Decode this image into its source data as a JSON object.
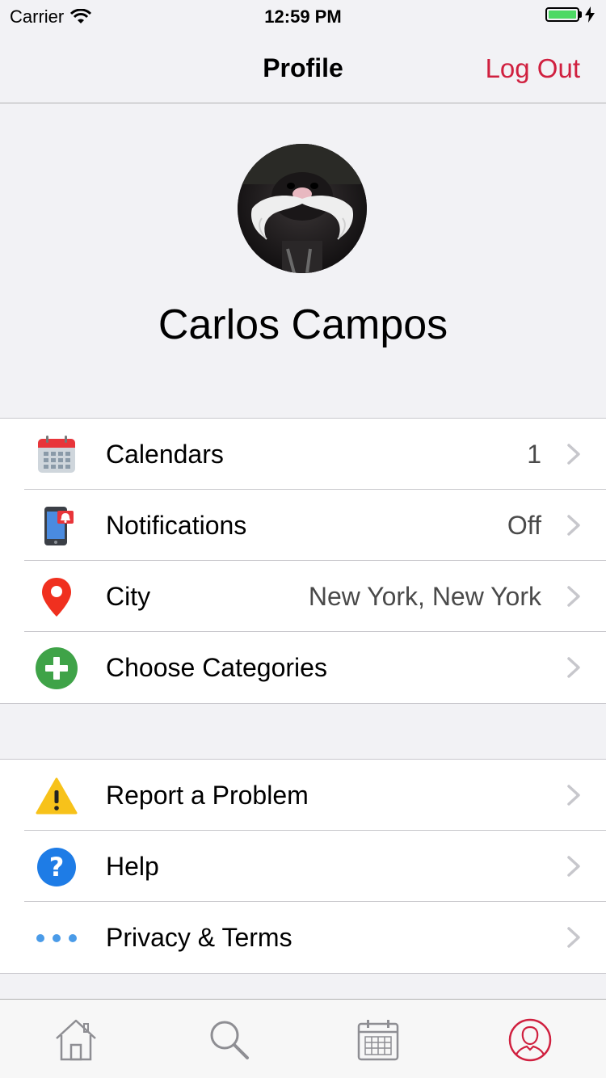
{
  "status_bar": {
    "carrier": "Carrier",
    "time": "12:59 PM"
  },
  "nav": {
    "title": "Profile",
    "logout_label": "Log Out"
  },
  "profile": {
    "name": "Carlos Campos"
  },
  "settings": [
    {
      "label": "Calendars",
      "value": "1",
      "icon": "calendar-icon"
    },
    {
      "label": "Notifications",
      "value": "Off",
      "icon": "phone-notification-icon"
    },
    {
      "label": "City",
      "value": "New York, New York",
      "icon": "location-pin-icon"
    },
    {
      "label": "Choose Categories",
      "value": "",
      "icon": "plus-circle-icon"
    }
  ],
  "support": [
    {
      "label": "Report a Problem",
      "icon": "warning-icon"
    },
    {
      "label": "Help",
      "icon": "question-icon"
    },
    {
      "label": "Privacy & Terms",
      "icon": "more-dots-icon"
    }
  ],
  "tab_bar": {
    "tabs": [
      {
        "name": "home",
        "icon": "home-icon"
      },
      {
        "name": "search",
        "icon": "search-icon"
      },
      {
        "name": "calendar",
        "icon": "calendar-tab-icon"
      },
      {
        "name": "profile",
        "icon": "profile-icon",
        "active": true
      }
    ]
  },
  "colors": {
    "accent": "#d0203f",
    "background": "#f2f2f5",
    "battery": "#4cd964",
    "pin": "#f0301f",
    "plus": "#3fa348",
    "warning": "#f7c21a",
    "help": "#1e7ce6",
    "dots": "#4a9be8"
  }
}
